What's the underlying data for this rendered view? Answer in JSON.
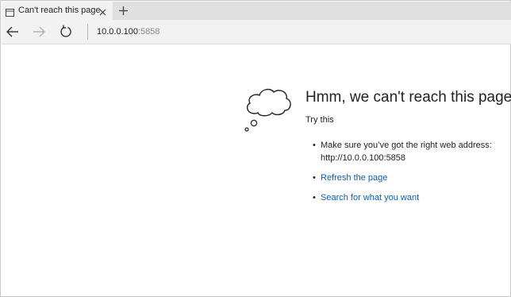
{
  "tab": {
    "title": "Can't reach this page",
    "icon": "page-icon",
    "close_icon": "close-icon"
  },
  "toolbar": {
    "new_tab_icon": "plus-icon",
    "back_icon": "back-arrow-icon",
    "forward_icon": "forward-arrow-icon",
    "refresh_icon": "refresh-icon"
  },
  "address_bar": {
    "host": "10.0.0.100",
    "port": ":5858"
  },
  "error_page": {
    "illustration": "thought-cloud-icon",
    "heading": "Hmm, we can't reach this page.",
    "subheading": "Try this",
    "suggestions": [
      {
        "line1": "Make sure you’ve got the right web address:",
        "line2": "http://10.0.0.100:5858"
      },
      {
        "label": "Refresh the page"
      },
      {
        "label": "Search for what you want"
      }
    ]
  },
  "colors": {
    "link": "#0a5ec2",
    "tabstrip": "#e0e0e0",
    "toolbar": "#f2f2f2",
    "text": "#222222"
  }
}
